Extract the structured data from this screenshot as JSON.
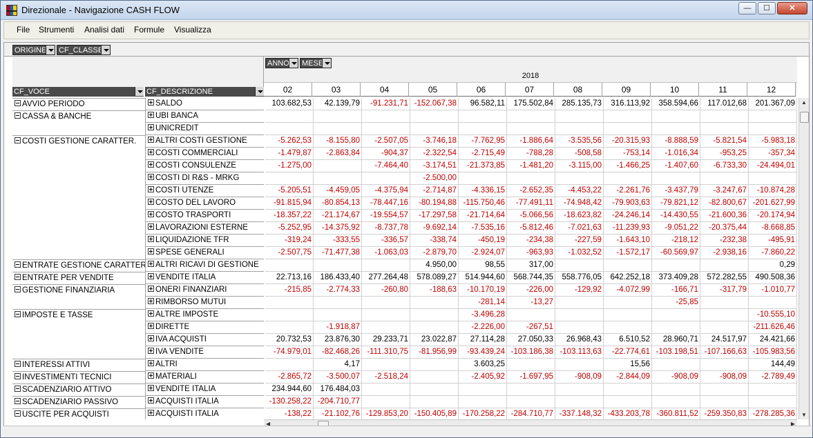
{
  "window": {
    "title": "Direzionale - Navigazione CASH FLOW",
    "min": "—",
    "max": "☐",
    "close": "✕"
  },
  "menu": [
    "File",
    "Strumenti",
    "Analisi dati",
    "Formule",
    "Visualizza"
  ],
  "filters": {
    "origine": "ORIGINE",
    "cf_classe": "CF_CLASSE",
    "anno": "ANNO",
    "mese": "MESE"
  },
  "headers": {
    "cf_voce": "CF_VOCE",
    "cf_descrizione": "CF_DESCRIZIONE",
    "year": "2018"
  },
  "months": [
    "02",
    "03",
    "04",
    "05",
    "06",
    "07",
    "08",
    "09",
    "10",
    "11",
    "12"
  ],
  "rows": [
    {
      "voce": "AVVIO PERIODO",
      "desc": "SALDO",
      "vals": [
        "103.682,53",
        "42.139,79",
        "-91.231,71",
        "-152.067,38",
        "96.582,11",
        "175.502,84",
        "285.135,73",
        "316.113,92",
        "358.594,66",
        "117.012,68",
        "201.367,09"
      ]
    },
    {
      "voce": "CASSA & BANCHE",
      "desc": "UBI BANCA",
      "vals": [
        "",
        "",
        "",
        "",
        "",
        "",
        "",
        "",
        "",
        "",
        ""
      ]
    },
    {
      "voce": "",
      "desc": "UNICREDIT",
      "vals": [
        "",
        "",
        "",
        "",
        "",
        "",
        "",
        "",
        "",
        "",
        ""
      ]
    },
    {
      "voce": "COSTI GESTIONE CARATTER.",
      "desc": "ALTRI COSTI GESTIONE",
      "vals": [
        "-5.262,53",
        "-8.155,80",
        "-2.507,05",
        "-3.746,18",
        "-7.762,95",
        "-1.886,64",
        "-3.535,56",
        "-20.315,93",
        "-8.888,59",
        "-5.821,54",
        "-5.983,18"
      ]
    },
    {
      "voce": "",
      "desc": "COSTI COMMERCIALI",
      "vals": [
        "-1.479,87",
        "-2.863,84",
        "-904,37",
        "-2.322,54",
        "-2.715,49",
        "-788,28",
        "-508,58",
        "-753,14",
        "-1.016,34",
        "-953,25",
        "-357,34"
      ]
    },
    {
      "voce": "",
      "desc": "COSTI CONSULENZE",
      "vals": [
        "-1.275,00",
        "",
        "-7.464,40",
        "-3.174,51",
        "-21.373,85",
        "-1.481,20",
        "-3.115,00",
        "-1.466,25",
        "-1.407,60",
        "-6.733,30",
        "-24.494,01"
      ]
    },
    {
      "voce": "",
      "desc": "COSTI DI R&S - MRKG",
      "vals": [
        "",
        "",
        "",
        "-2.500,00",
        "",
        "",
        "",
        "",
        "",
        "",
        ""
      ]
    },
    {
      "voce": "",
      "desc": "COSTI UTENZE",
      "vals": [
        "-5.205,51",
        "-4.459,05",
        "-4.375,94",
        "-2.714,87",
        "-4.336,15",
        "-2.652,35",
        "-4.453,22",
        "-2.261,76",
        "-3.437,79",
        "-3.247,67",
        "-10.874,28"
      ]
    },
    {
      "voce": "",
      "desc": "COSTO DEL LAVORO",
      "vals": [
        "-91.815,94",
        "-80.854,13",
        "-78.447,16",
        "-80.194,88",
        "-115.750,46",
        "-77.491,11",
        "-74.948,42",
        "-79.903,63",
        "-79.821,12",
        "-82.800,67",
        "-201.627,99"
      ]
    },
    {
      "voce": "",
      "desc": "COSTO TRASPORTI",
      "vals": [
        "-18.357,22",
        "-21.174,67",
        "-19.554,57",
        "-17.297,58",
        "-21.714,64",
        "-5.066,56",
        "-18.623,82",
        "-24.246,14",
        "-14.430,55",
        "-21.600,36",
        "-20.174,94"
      ]
    },
    {
      "voce": "",
      "desc": "LAVORAZIONI ESTERNE",
      "vals": [
        "-5.252,95",
        "-14.375,92",
        "-8.737,78",
        "-9.692,14",
        "-7.535,16",
        "-5.812,46",
        "-7.021,63",
        "-11.239,93",
        "-9.051,22",
        "-20.375,44",
        "-8.668,85"
      ]
    },
    {
      "voce": "",
      "desc": "LIQUIDAZIONE TFR",
      "vals": [
        "-319,24",
        "-333,55",
        "-336,57",
        "-338,74",
        "-450,19",
        "-234,38",
        "-227,59",
        "-1.643,10",
        "-218,12",
        "-232,38",
        "-495,91"
      ]
    },
    {
      "voce": "",
      "desc": "SPESE GENERALI",
      "vals": [
        "-2.507,75",
        "-71.477,38",
        "-1.063,03",
        "-2.879,70",
        "-2.924,07",
        "-963,93",
        "-1.032,52",
        "-1.572,17",
        "-60.569,97",
        "-2.938,16",
        "-7.860,22"
      ]
    },
    {
      "voce": "ENTRATE GESTIONE CARATTER.",
      "desc": "ALTRI RICAVI DI GESTIONE",
      "vals": [
        "",
        "",
        "",
        "4.950,00",
        "98,55",
        "317,00",
        "",
        "",
        "",
        "",
        "0,29"
      ]
    },
    {
      "voce": "ENTRATE PER VENDITE",
      "desc": "VENDITE ITALIA",
      "vals": [
        "22.713,16",
        "186.433,40",
        "277.264,48",
        "578.089,27",
        "514.944,60",
        "568.744,35",
        "558.776,05",
        "642.252,18",
        "373.409,28",
        "572.282,55",
        "490.508,36"
      ]
    },
    {
      "voce": "GESTIONE FINANZIARIA",
      "desc": "ONERI FINANZIARI",
      "vals": [
        "-215,85",
        "-2.774,33",
        "-260,80",
        "-188,63",
        "-10.170,19",
        "-226,00",
        "-129,92",
        "-4.072,99",
        "-166,71",
        "-317,79",
        "-1.010,77"
      ]
    },
    {
      "voce": "",
      "desc": "RIMBORSO MUTUI",
      "vals": [
        "",
        "",
        "",
        "",
        "-281,14",
        "-13,27",
        "",
        "",
        "-25,85",
        "",
        ""
      ]
    },
    {
      "voce": "IMPOSTE E TASSE",
      "desc": "ALTRE IMPOSTE",
      "vals": [
        "",
        "",
        "",
        "",
        "-3.496,28",
        "",
        "",
        "",
        "",
        "",
        "-10.555,10"
      ]
    },
    {
      "voce": "",
      "desc": "DIRETTE",
      "vals": [
        "",
        "-1.918,87",
        "",
        "",
        "-2.226,00",
        "-267,51",
        "",
        "",
        "",
        "",
        "-211.626,46"
      ]
    },
    {
      "voce": "",
      "desc": "IVA ACQUISTI",
      "vals": [
        "20.732,53",
        "23.876,30",
        "29.233,71",
        "23.022,87",
        "27.114,28",
        "27.050,33",
        "26.968,43",
        "6.510,52",
        "28.960,71",
        "24.517,97",
        "24.421,66"
      ]
    },
    {
      "voce": "",
      "desc": "IVA VENDITE",
      "vals": [
        "-74.979,01",
        "-82.468,26",
        "-111.310,75",
        "-81.956,99",
        "-93.439,24",
        "-103.186,38",
        "-103.113,63",
        "-22.774,61",
        "-103.198,51",
        "-107.166,63",
        "-105.983,56"
      ]
    },
    {
      "voce": "INTERESSI ATTIVI",
      "desc": "ALTRI",
      "vals": [
        "",
        "4,17",
        "",
        "",
        "3.603,25",
        "",
        "",
        "15,56",
        "",
        "",
        "144,49"
      ]
    },
    {
      "voce": "INVESTIMENTI TECNICI",
      "desc": "MATERIALI",
      "vals": [
        "-2.865,72",
        "-3.500,07",
        "-2.518,24",
        "",
        "-2.405,92",
        "-1.697,95",
        "-908,09",
        "-2.844,09",
        "-908,09",
        "-908,09",
        "-2.789,49"
      ]
    },
    {
      "voce": "SCADENZIARIO ATTIVO",
      "desc": "VENDITE ITALIA",
      "vals": [
        "234.944,60",
        "176.484,03",
        "",
        "",
        "",
        "",
        "",
        "",
        "",
        "",
        ""
      ]
    },
    {
      "voce": "SCADENZIARIO PASSIVO",
      "desc": "ACQUISTI ITALIA",
      "vals": [
        "-130.258,22",
        "-204.710,77",
        "",
        "",
        "",
        "",
        "",
        "",
        "",
        "",
        ""
      ]
    },
    {
      "voce": "USCITE PER ACQUISTI",
      "desc": "ACQUISTI ITALIA",
      "vals": [
        "-138,22",
        "-21.102,76",
        "-129.853,20",
        "-150.405,89",
        "-170.258,22",
        "-284.710,77",
        "-337.148,32",
        "-433.203,78",
        "-360.811,52",
        "-259.350,83",
        "-278.285,36"
      ]
    }
  ]
}
